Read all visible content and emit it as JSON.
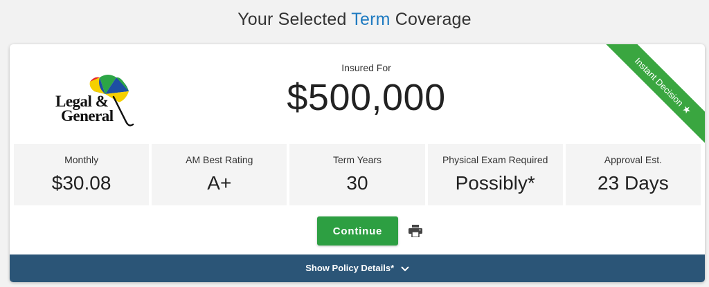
{
  "page_title": {
    "prefix": "Your Selected ",
    "accent": "Term",
    "suffix": " Coverage",
    "accent_color": "#1f7bc1"
  },
  "carrier": {
    "logo_line1": "Legal &",
    "logo_line2": "General"
  },
  "insured": {
    "label": "Insured For",
    "amount": "$500,000"
  },
  "ribbon": {
    "label": "Instant Decision",
    "icon": "star-icon",
    "color": "#3aa640"
  },
  "stats": [
    {
      "label": "Monthly",
      "value": "$30.08"
    },
    {
      "label": "AM Best Rating",
      "value": "A+"
    },
    {
      "label": "Term Years",
      "value": "30"
    },
    {
      "label": "Physical Exam Required",
      "value": "Possibly*"
    },
    {
      "label": "Approval Est.",
      "value": "23 Days"
    }
  ],
  "actions": {
    "continue_label": "Continue",
    "continue_color": "#2d9f42",
    "print_icon": "print-icon"
  },
  "details": {
    "label": "Show Policy Details*",
    "icon": "chevron-down-icon",
    "bar_color": "#2b5577"
  }
}
